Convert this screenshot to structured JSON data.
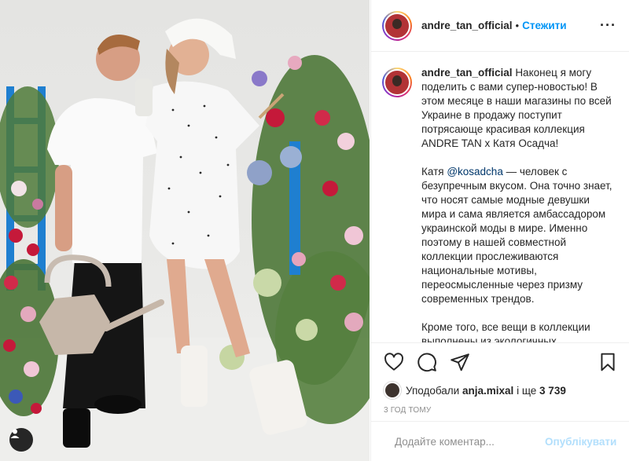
{
  "post": {
    "username": "andre_tan_official",
    "follow_label": "Стежити",
    "separator": "•",
    "more_label": "···",
    "caption": "Наконец я могу поделить с вами супер-новостью! В этом месяце в наши магазины по всей Украине в продажу поступит потрясающе красивая коллекция ANDRE TAN x Катя Осадча!\n\nКатя ",
    "mention": "@kosadcha",
    "caption_rest": " — человек с безупречным вкусом. Она точно знает, что носят самые модные девушки мира и сама является амбассадором украинской моды в мире. Именно поэтому в нашей совместной коллекции прослеживаются национальные мотивы, переосмысленные через призму современных трендов.\n\nКроме того, все вещи в коллекции выполнены из экологичных",
    "likes": {
      "prefix": "Уподобали",
      "user": "anja.mixal",
      "middle": "і ще",
      "count": "3 739"
    },
    "time": "3 год тому",
    "comment": {
      "placeholder": "Додайте коментар...",
      "post_label": "Опублікувати"
    }
  },
  "icons": {
    "like": "heart-icon",
    "comment": "comment-icon",
    "share": "share-icon",
    "save": "bookmark-icon",
    "emoji": "emoji-icon",
    "more": "more-icon"
  },
  "colors": {
    "accent": "#0095f6",
    "text": "#262626",
    "muted": "#8e8e8e",
    "border": "#efefef",
    "post_disabled": "#b2dffc"
  }
}
